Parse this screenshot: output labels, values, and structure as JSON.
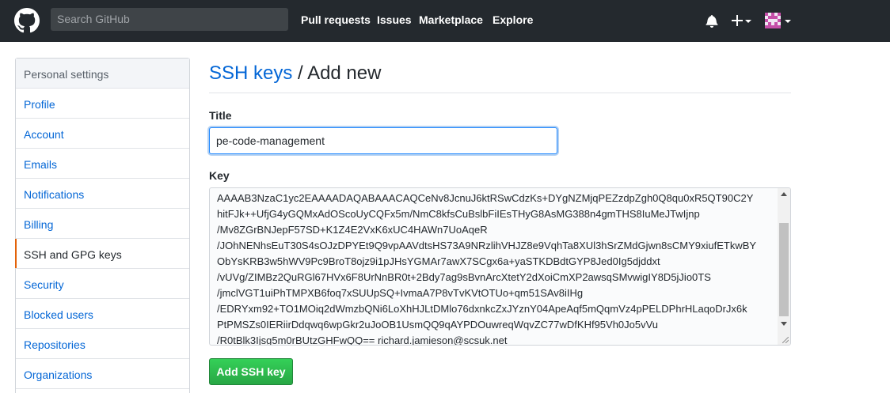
{
  "header": {
    "search_placeholder": "Search GitHub",
    "nav": [
      "Pull requests",
      "Issues",
      "Marketplace",
      "Explore"
    ]
  },
  "sidebar": {
    "heading": "Personal settings",
    "items": [
      {
        "label": "Profile",
        "selected": false
      },
      {
        "label": "Account",
        "selected": false
      },
      {
        "label": "Emails",
        "selected": false
      },
      {
        "label": "Notifications",
        "selected": false
      },
      {
        "label": "Billing",
        "selected": false
      },
      {
        "label": "SSH and GPG keys",
        "selected": true
      },
      {
        "label": "Security",
        "selected": false
      },
      {
        "label": "Blocked users",
        "selected": false
      },
      {
        "label": "Repositories",
        "selected": false
      },
      {
        "label": "Organizations",
        "selected": false
      }
    ]
  },
  "main": {
    "breadcrumb_link": "SSH keys",
    "breadcrumb_separator": " / ",
    "breadcrumb_current": "Add new",
    "title_label": "Title",
    "title_value": "pe-code-management",
    "key_label": "Key",
    "key_value": "AAAAB3NzaC1yc2EAAAADAQABAAACAQCeNv8JcnuJ6ktRSwCdzKs+DYgNZMjqPEZzdpZgh0Q8qu0xR5QT90C2Y\nhitFJk++UfjG4yGQMxAdOScoUyCQFx5m/NmC8kfsCuBslbFiIEsTHyG8AsMG388n4gmTHS8IuMeJTwIjnp\n/Mv8ZGrBNJepF57SD+K1Z4E2VxK6xUC4HAWn7UoAqeR\n/JOhNENhsEuT30S4sOJzDPYEt9Q9vpAAVdtsHS73A9NRzlihVHJZ8e9VqhTa8XUl3hSrZMdGjwn8sCMY9xiufETkwBY\nObYsKRB3w5hWV9Pc9BroT8ojz9i1pJHsYGMAr7awX7SCgx6a+yaSTKDBdtGYP8Jed0Ig5djddxt\n/vUVg/ZIMBz2QuRGl67HVx6F8UrNnBR0t+2Bdy7ag9sBvnArcXtetY2dXoiCmXP2awsqSMvwigIY8D5jJio0TS\n/jmclVGT1uiPhTMPXB6foq7xSUUpSQ+IvmaA7P8vTvKVtOTUo+qm51SAv8iIHg\n/EDRYxm92+TO1MOiq2dWmzbQNi6LoXhHJLtDMlo76dxnkcZxJYznY04ApeAqf5mQqmVz4pPELDPhrHLaqoDrJx6k\nPtPMSZs0IERiirDdqwq6wpGkr2uJoOB1UsmQQ9qAYPDOuwreqWqvZC77wDfKHf95Vh0Jo5vVu\n/R0tBlk3Ijsg5m0rBUtzGHFwQQ== richard.jamieson@scsuk.net",
    "submit_label": "Add SSH key"
  }
}
